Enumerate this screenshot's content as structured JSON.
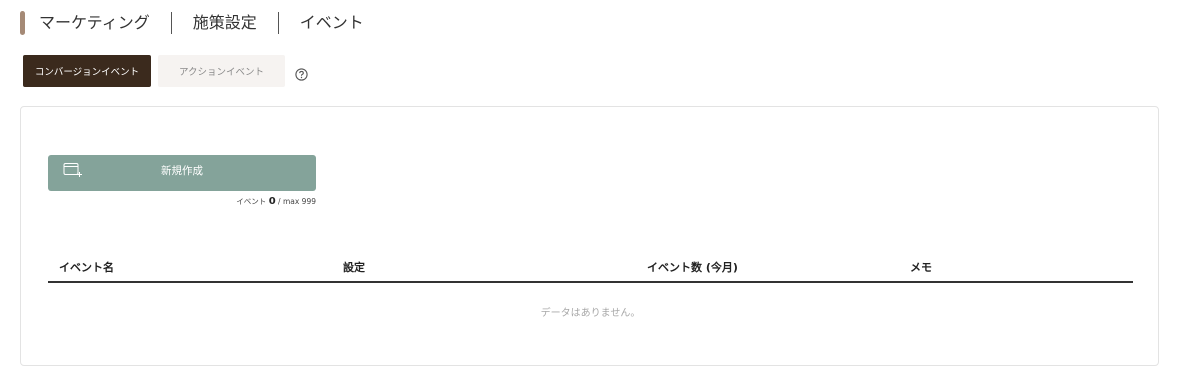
{
  "breadcrumb": {
    "items": [
      "マーケティング",
      "施策設定",
      "イベント"
    ]
  },
  "tabs": {
    "active_label": "コンバージョンイベント",
    "inactive_label": "アクションイベント",
    "help_icon": "question-circle-icon"
  },
  "create_button": {
    "label": "新規作成",
    "icon": "add-window-icon"
  },
  "event_count": {
    "prefix": "イベント",
    "count": "0",
    "suffix": "/ max 999"
  },
  "table": {
    "columns": [
      "イベント名",
      "設定",
      "イベント数 (今月)",
      "メモ"
    ],
    "empty_message": "データはありません。"
  },
  "colors": {
    "active_tab": "#3b2a1d",
    "inactive_tab": "#f6f3f1",
    "create_button": "#84a39a",
    "breadcrumb_marker": "#a58a76"
  }
}
